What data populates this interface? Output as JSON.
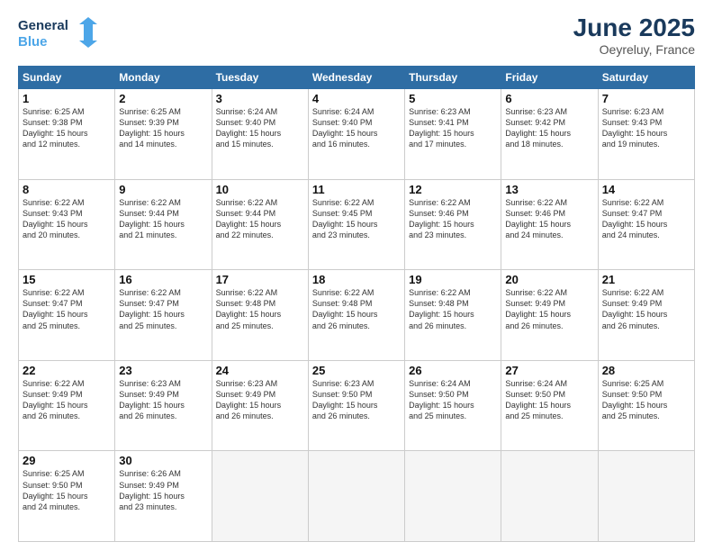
{
  "header": {
    "logo_line1": "General",
    "logo_line2": "Blue",
    "month": "June 2025",
    "location": "Oeyreluy, France"
  },
  "weekdays": [
    "Sunday",
    "Monday",
    "Tuesday",
    "Wednesday",
    "Thursday",
    "Friday",
    "Saturday"
  ],
  "weeks": [
    [
      {
        "day": "1",
        "lines": [
          "Sunrise: 6:25 AM",
          "Sunset: 9:38 PM",
          "Daylight: 15 hours",
          "and 12 minutes."
        ]
      },
      {
        "day": "2",
        "lines": [
          "Sunrise: 6:25 AM",
          "Sunset: 9:39 PM",
          "Daylight: 15 hours",
          "and 14 minutes."
        ]
      },
      {
        "day": "3",
        "lines": [
          "Sunrise: 6:24 AM",
          "Sunset: 9:40 PM",
          "Daylight: 15 hours",
          "and 15 minutes."
        ]
      },
      {
        "day": "4",
        "lines": [
          "Sunrise: 6:24 AM",
          "Sunset: 9:40 PM",
          "Daylight: 15 hours",
          "and 16 minutes."
        ]
      },
      {
        "day": "5",
        "lines": [
          "Sunrise: 6:23 AM",
          "Sunset: 9:41 PM",
          "Daylight: 15 hours",
          "and 17 minutes."
        ]
      },
      {
        "day": "6",
        "lines": [
          "Sunrise: 6:23 AM",
          "Sunset: 9:42 PM",
          "Daylight: 15 hours",
          "and 18 minutes."
        ]
      },
      {
        "day": "7",
        "lines": [
          "Sunrise: 6:23 AM",
          "Sunset: 9:43 PM",
          "Daylight: 15 hours",
          "and 19 minutes."
        ]
      }
    ],
    [
      {
        "day": "8",
        "lines": [
          "Sunrise: 6:22 AM",
          "Sunset: 9:43 PM",
          "Daylight: 15 hours",
          "and 20 minutes."
        ]
      },
      {
        "day": "9",
        "lines": [
          "Sunrise: 6:22 AM",
          "Sunset: 9:44 PM",
          "Daylight: 15 hours",
          "and 21 minutes."
        ]
      },
      {
        "day": "10",
        "lines": [
          "Sunrise: 6:22 AM",
          "Sunset: 9:44 PM",
          "Daylight: 15 hours",
          "and 22 minutes."
        ]
      },
      {
        "day": "11",
        "lines": [
          "Sunrise: 6:22 AM",
          "Sunset: 9:45 PM",
          "Daylight: 15 hours",
          "and 23 minutes."
        ]
      },
      {
        "day": "12",
        "lines": [
          "Sunrise: 6:22 AM",
          "Sunset: 9:46 PM",
          "Daylight: 15 hours",
          "and 23 minutes."
        ]
      },
      {
        "day": "13",
        "lines": [
          "Sunrise: 6:22 AM",
          "Sunset: 9:46 PM",
          "Daylight: 15 hours",
          "and 24 minutes."
        ]
      },
      {
        "day": "14",
        "lines": [
          "Sunrise: 6:22 AM",
          "Sunset: 9:47 PM",
          "Daylight: 15 hours",
          "and 24 minutes."
        ]
      }
    ],
    [
      {
        "day": "15",
        "lines": [
          "Sunrise: 6:22 AM",
          "Sunset: 9:47 PM",
          "Daylight: 15 hours",
          "and 25 minutes."
        ]
      },
      {
        "day": "16",
        "lines": [
          "Sunrise: 6:22 AM",
          "Sunset: 9:47 PM",
          "Daylight: 15 hours",
          "and 25 minutes."
        ]
      },
      {
        "day": "17",
        "lines": [
          "Sunrise: 6:22 AM",
          "Sunset: 9:48 PM",
          "Daylight: 15 hours",
          "and 25 minutes."
        ]
      },
      {
        "day": "18",
        "lines": [
          "Sunrise: 6:22 AM",
          "Sunset: 9:48 PM",
          "Daylight: 15 hours",
          "and 26 minutes."
        ]
      },
      {
        "day": "19",
        "lines": [
          "Sunrise: 6:22 AM",
          "Sunset: 9:48 PM",
          "Daylight: 15 hours",
          "and 26 minutes."
        ]
      },
      {
        "day": "20",
        "lines": [
          "Sunrise: 6:22 AM",
          "Sunset: 9:49 PM",
          "Daylight: 15 hours",
          "and 26 minutes."
        ]
      },
      {
        "day": "21",
        "lines": [
          "Sunrise: 6:22 AM",
          "Sunset: 9:49 PM",
          "Daylight: 15 hours",
          "and 26 minutes."
        ]
      }
    ],
    [
      {
        "day": "22",
        "lines": [
          "Sunrise: 6:22 AM",
          "Sunset: 9:49 PM",
          "Daylight: 15 hours",
          "and 26 minutes."
        ]
      },
      {
        "day": "23",
        "lines": [
          "Sunrise: 6:23 AM",
          "Sunset: 9:49 PM",
          "Daylight: 15 hours",
          "and 26 minutes."
        ]
      },
      {
        "day": "24",
        "lines": [
          "Sunrise: 6:23 AM",
          "Sunset: 9:49 PM",
          "Daylight: 15 hours",
          "and 26 minutes."
        ]
      },
      {
        "day": "25",
        "lines": [
          "Sunrise: 6:23 AM",
          "Sunset: 9:50 PM",
          "Daylight: 15 hours",
          "and 26 minutes."
        ]
      },
      {
        "day": "26",
        "lines": [
          "Sunrise: 6:24 AM",
          "Sunset: 9:50 PM",
          "Daylight: 15 hours",
          "and 25 minutes."
        ]
      },
      {
        "day": "27",
        "lines": [
          "Sunrise: 6:24 AM",
          "Sunset: 9:50 PM",
          "Daylight: 15 hours",
          "and 25 minutes."
        ]
      },
      {
        "day": "28",
        "lines": [
          "Sunrise: 6:25 AM",
          "Sunset: 9:50 PM",
          "Daylight: 15 hours",
          "and 25 minutes."
        ]
      }
    ],
    [
      {
        "day": "29",
        "lines": [
          "Sunrise: 6:25 AM",
          "Sunset: 9:50 PM",
          "Daylight: 15 hours",
          "and 24 minutes."
        ]
      },
      {
        "day": "30",
        "lines": [
          "Sunrise: 6:26 AM",
          "Sunset: 9:49 PM",
          "Daylight: 15 hours",
          "and 23 minutes."
        ]
      },
      {
        "day": "",
        "lines": []
      },
      {
        "day": "",
        "lines": []
      },
      {
        "day": "",
        "lines": []
      },
      {
        "day": "",
        "lines": []
      },
      {
        "day": "",
        "lines": []
      }
    ]
  ]
}
